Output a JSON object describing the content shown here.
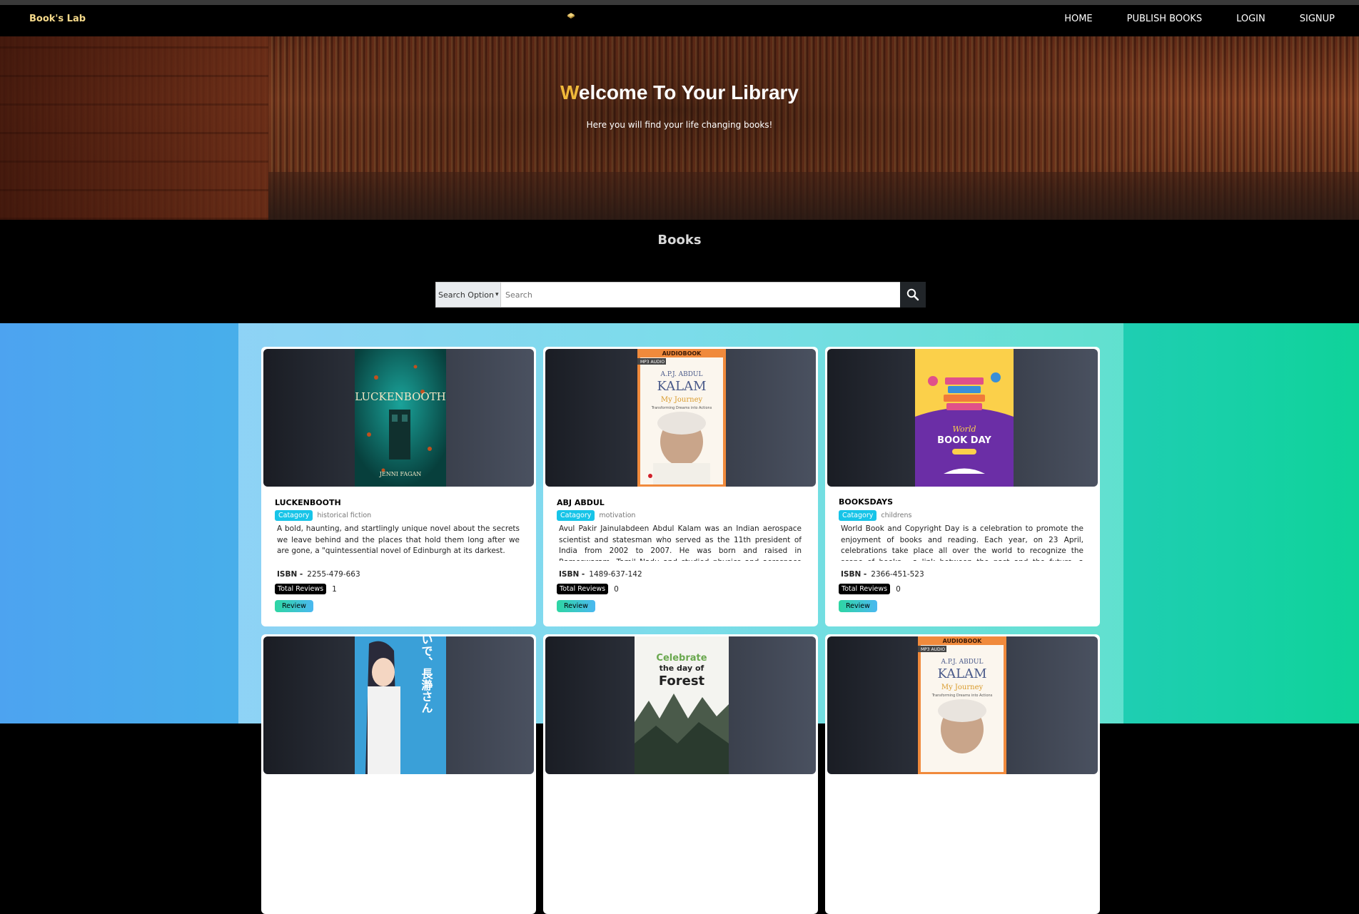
{
  "navbar": {
    "brand": "Book's Lab",
    "links": [
      "HOME",
      "PUBLISH BOOKS",
      "LOGIN",
      "SIGNUP"
    ]
  },
  "hero": {
    "title_first_letter": "W",
    "title_rest": "elcome To Your Library",
    "subtitle": "Here you will find your life changing books!"
  },
  "books_section": {
    "heading": "Books",
    "search_option": "Search Option",
    "search_placeholder": "Search"
  },
  "labels": {
    "category": "Catagory",
    "isbn": "ISBN -",
    "total_reviews": "Total Reviews",
    "review_button": "Review"
  },
  "books": [
    {
      "title": "LUCKENBOOTH",
      "category": "historical fiction",
      "description": "A bold, haunting, and startlingly unique novel about the secrets we leave behind and the places that hold them long after we are gone, a \"quintessential novel of Edinburgh at its darkest.",
      "isbn": "2255-479-663",
      "total_reviews": "1",
      "cover": {
        "title": "LUCKENBOOTH",
        "author": "JENNI FAGAN"
      }
    },
    {
      "title": "ABJ ABDUL",
      "category": "motivation",
      "description": "Avul Pakir Jainulabdeen Abdul Kalam was an Indian aerospace scientist and statesman who served as the 11th president of India from 2002 to 2007. He was born and raised in Rameswaram, Tamil Nadu and studied physics and aerospace engineering",
      "isbn": "1489-637-142",
      "total_reviews": "0",
      "cover": {
        "banner": "AUDIOBOOK",
        "tag": "MP3 AUDIO",
        "author": "A.P.J. ABDUL",
        "name": "KALAM",
        "title": "My Journey",
        "subtitle": "Transforming Dreams into Actions"
      }
    },
    {
      "title": "BOOKSDAYS",
      "category": "childrens",
      "description": "World Book and Copyright Day is a celebration to promote the enjoyment of books and reading. Each year, on 23 April, celebrations take place all over the world to recognize the scope of books - a link between the past and the future, a bridge between",
      "isbn": "2366-451-523",
      "total_reviews": "0",
      "cover": {
        "line1": "World",
        "line2": "BOOK DAY"
      }
    },
    {
      "cover": {
        "text": "イジらないで、長瀞さん"
      }
    },
    {
      "cover": {
        "line1": "Celebrate",
        "line2": "the day of",
        "line3": "Forest"
      }
    },
    {
      "cover": {
        "banner": "AUDIOBOOK",
        "tag": "MP3 AUDIO",
        "author": "A.P.J. ABDUL",
        "name": "KALAM",
        "title": "My Journey",
        "subtitle": "Transforming Dreams into Actions"
      }
    }
  ],
  "colors": {
    "brand": "#f5d98a",
    "accent_letter": "#f0b93a",
    "category_badge": "#17c4e8",
    "bg_left": "#4da3f0",
    "bg_right": "#0fd39a"
  }
}
